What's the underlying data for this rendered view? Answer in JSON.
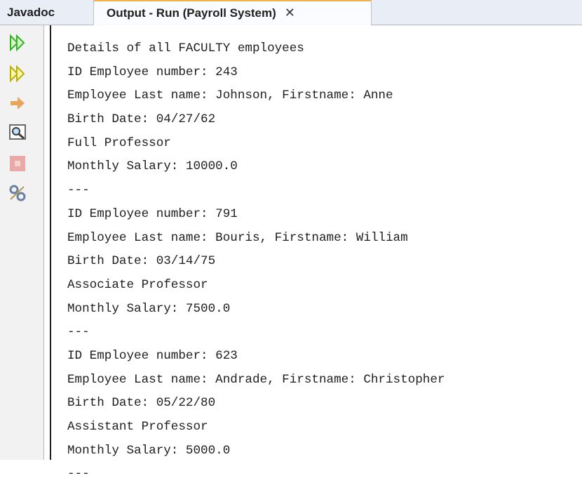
{
  "tabs": [
    {
      "label": "Javadoc"
    },
    {
      "label": "Output - Run (Payroll System)"
    }
  ],
  "close_glyph": "✕",
  "toolbar_icons": [
    "rerun-icon",
    "rerun-with-options-icon",
    "continue-arrow-icon",
    "find-icon",
    "stop-icon",
    "settings-icon"
  ],
  "colors": {
    "accent_tab": "#f0b34a",
    "run_green": "#35b326",
    "arrow_orange": "#e9a45c"
  },
  "output_lines": [
    "Details of all FACULTY employees",
    "ID Employee number: 243",
    "Employee Last name: Johnson, Firstname: Anne",
    "Birth Date: 04/27/62",
    "Full Professor",
    "Monthly Salary: 10000.0",
    "---",
    "ID Employee number: 791",
    "Employee Last name: Bouris, Firstname: William",
    "Birth Date: 03/14/75",
    "Associate Professor",
    "Monthly Salary: 7500.0",
    "---",
    "ID Employee number: 623",
    "Employee Last name: Andrade, Firstname: Christopher",
    "Birth Date: 05/22/80",
    "Assistant Professor",
    "Monthly Salary: 5000.0",
    "---"
  ]
}
